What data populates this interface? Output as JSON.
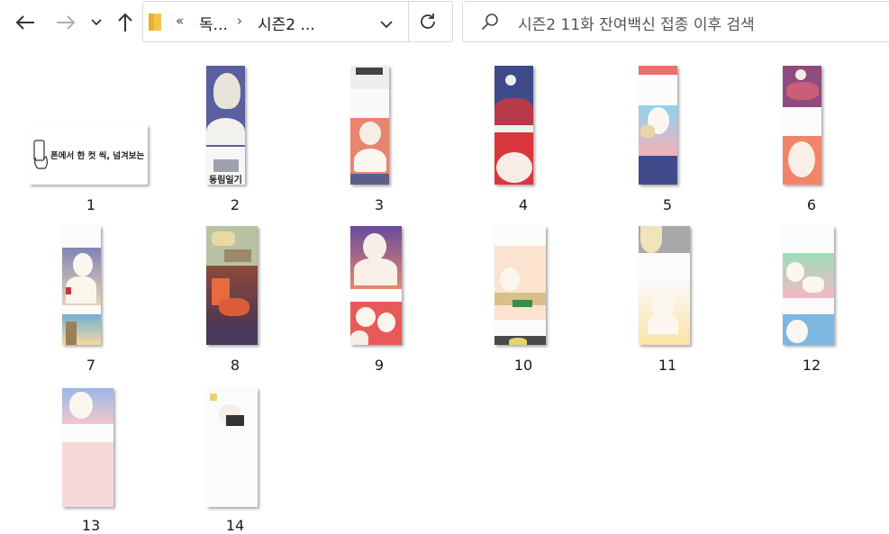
{
  "toolbar": {
    "back_icon": "back-arrow-icon",
    "forward_icon": "forward-arrow-icon",
    "recent_icon": "chevron-down-icon",
    "up_icon": "up-arrow-icon"
  },
  "address_bar": {
    "overflow": "«",
    "crumbs": [
      "독...",
      "시즌2 ..."
    ],
    "separator": "›",
    "refresh_icon": "refresh-icon"
  },
  "search": {
    "placeholder": "시즌2 11화 잔여백신 접종 이후 검색",
    "icon": "search-icon"
  },
  "files": [
    {
      "name": "1",
      "thumb_text": "폰에서 한 컷 씩, 넘겨보는 컷툰"
    },
    {
      "name": "2",
      "thumb_text": "동림일기"
    },
    {
      "name": "3",
      "thumb_text": ""
    },
    {
      "name": "4",
      "thumb_text": ""
    },
    {
      "name": "5",
      "thumb_text": ""
    },
    {
      "name": "6",
      "thumb_text": ""
    },
    {
      "name": "7",
      "thumb_text": ""
    },
    {
      "name": "8",
      "thumb_text": ""
    },
    {
      "name": "9",
      "thumb_text": ""
    },
    {
      "name": "10",
      "thumb_text": ""
    },
    {
      "name": "11",
      "thumb_text": ""
    },
    {
      "name": "12",
      "thumb_text": ""
    },
    {
      "name": "13",
      "thumb_text": ""
    },
    {
      "name": "14",
      "thumb_text": ""
    }
  ]
}
